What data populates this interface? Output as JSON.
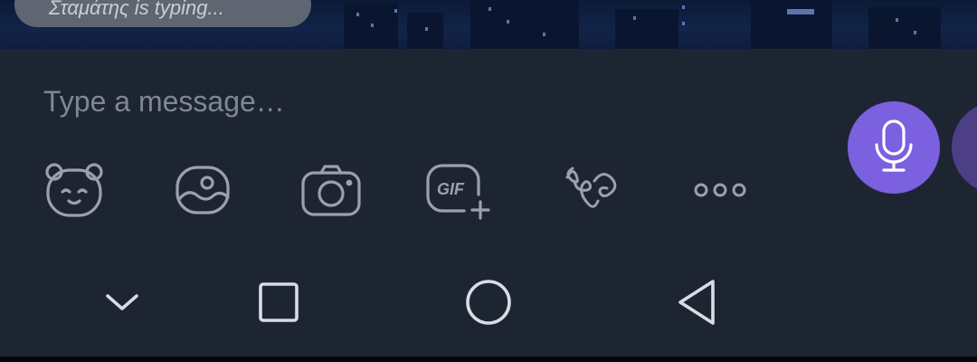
{
  "status": {
    "typing_text": "Σταμάτης is typing..."
  },
  "composer": {
    "placeholder": "Type a message…",
    "value": "",
    "tools": [
      {
        "icon": "sticker-bear-icon"
      },
      {
        "icon": "gallery-icon"
      },
      {
        "icon": "camera-icon"
      },
      {
        "icon": "gif-add-icon",
        "label": "GIF"
      },
      {
        "icon": "doodle-icon"
      },
      {
        "icon": "more-icon"
      }
    ],
    "mic_icon": "microphone-icon"
  },
  "navbar": {
    "buttons": [
      {
        "icon": "chevron-down-icon"
      },
      {
        "icon": "recent-apps-icon"
      },
      {
        "icon": "home-icon"
      },
      {
        "icon": "back-icon"
      }
    ]
  },
  "colors": {
    "panel": "#1e2532",
    "accent": "#7b60e0",
    "icon": "#9aa1ad",
    "placeholder": "#7f8794"
  }
}
